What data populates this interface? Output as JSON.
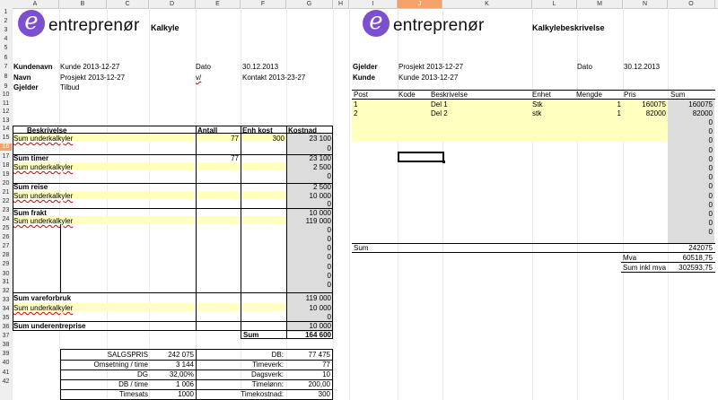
{
  "columns": [
    "A",
    "B",
    "C",
    "D",
    "E",
    "F",
    "G",
    "H",
    "I",
    "J",
    "K",
    "L",
    "M",
    "N",
    "O"
  ],
  "selected_column": "J",
  "rows": [
    "1",
    "2",
    "3",
    "4",
    "5",
    "6",
    "7",
    "8",
    "9",
    "10",
    "11",
    "12",
    "13",
    "14",
    "15",
    "16",
    "17",
    "18",
    "19",
    "20",
    "21",
    "22",
    "23",
    "24",
    "25",
    "26",
    "27",
    "28",
    "29",
    "30",
    "31",
    "32",
    "33",
    "34",
    "35",
    "36",
    "37",
    "38",
    "39",
    "40",
    "41",
    "42"
  ],
  "selected_row": "16",
  "left": {
    "logo_text": "entreprenør",
    "title": "Kalkyle",
    "kundenavn_label": "Kundenavn",
    "kundenavn": "Kunde 2013-12-27",
    "navn_label": "Navn",
    "navn": "Prosjekt 2013-12-27",
    "gjelder_label": "Gjelder",
    "gjelder": "Tilbud",
    "dato_label": "Dato",
    "dato": "30.12.2013",
    "v_label": "v/",
    "kontakt": "Kontakt 2013-23-27",
    "headers": {
      "beskrivelse": "Beskrivelse",
      "antall": "Antall",
      "enh_kost": "Enh kost",
      "kostnad": "Kostnad"
    },
    "sum_under": "Sum underkalkyler",
    "row14": {
      "antall": "77",
      "enh": "300",
      "kostnad": "23 100"
    },
    "sum_timer": "Sum timer",
    "sum_timer_antall": "77",
    "sum_timer_kost": "23 100",
    "row17_kost": "2 500",
    "sum_reise": "Sum reise",
    "sum_reise_kost": "2 500",
    "row20_kost": "10 000",
    "sum_frakt": "Sum frakt",
    "sum_frakt_kost": "10 000",
    "row23_kost": "119 000",
    "sum_vare": "Sum vareforbruk",
    "sum_vare_kost": "119 000",
    "row32_kost": "10 000",
    "sum_under_ent": "Sum underentreprise",
    "sum_under_ent_kost": "10 000",
    "sum_label": "Sum",
    "sum_total": "164 600",
    "zero": "0",
    "summary": [
      {
        "l1": "SALGSPRIS",
        "v1": "242 075",
        "l2": "DB:",
        "v2": "77 475"
      },
      {
        "l1": "Omsetning / time",
        "v1": "3 144",
        "l2": "Timeverk:",
        "v2": "77"
      },
      {
        "l1": "DG",
        "v1": "32,00%",
        "l2": "Dagsverk:",
        "v2": "10"
      },
      {
        "l1": "DB / time",
        "v1": "1 006",
        "l2": "Timelønn:",
        "v2": "200,00"
      },
      {
        "l1": "Timesats",
        "v1": "1000",
        "l2": "Timekostnad:",
        "v2": "300"
      }
    ]
  },
  "right": {
    "logo_text": "entreprenør",
    "title": "Kalkylebeskrivelse",
    "gjelder_label": "Gjelder",
    "gjelder": "Prosjekt 2013-12-27",
    "kunde_label": "Kunde",
    "kunde": "Kunde 2013-12-27",
    "dato_label": "Dato",
    "dato": "30.12.2013",
    "headers": {
      "post": "Post",
      "kode": "Kode",
      "beskrivelse": "Beskrivelse",
      "enhet": "Enhet",
      "mengde": "Mengde",
      "pris": "Pris",
      "sum": "Sum"
    },
    "lines": [
      {
        "post": "1",
        "beskrivelse": "Del 1",
        "enhet": "Stk",
        "mengde": "1",
        "pris": "160075",
        "sum": "160075"
      },
      {
        "post": "2",
        "beskrivelse": "Del 2",
        "enhet": "stk",
        "mengde": "1",
        "pris": "82000",
        "sum": "82000"
      }
    ],
    "zero": "0",
    "sum_label": "Sum",
    "sum": "242075",
    "mva_label": "Mva",
    "mva": "60518,75",
    "sum_inkl_label": "Sum inkl mva",
    "sum_inkl": "302593,75"
  }
}
